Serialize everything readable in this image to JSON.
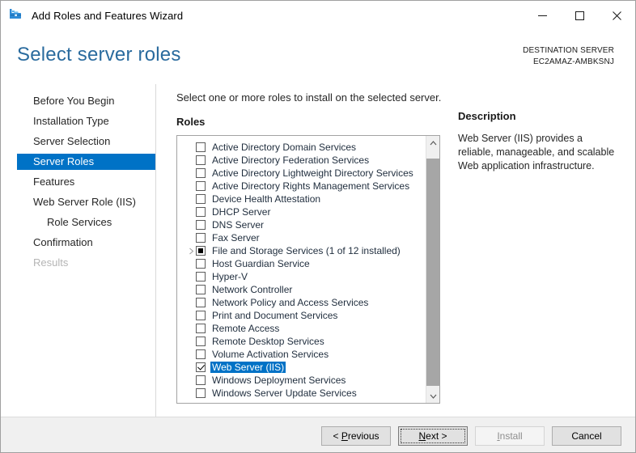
{
  "window": {
    "title": "Add Roles and Features Wizard",
    "icon": "wizard-toolbox-icon",
    "minimize_label": "—",
    "maximize_label": "□",
    "close_label": "✕"
  },
  "header": {
    "page_title": "Select server roles",
    "destination_label": "DESTINATION SERVER",
    "destination_server": "EC2AMAZ-AMBKSNJ",
    "accent_color": "#2a6b9e"
  },
  "nav": {
    "items": [
      {
        "label": "Before You Begin",
        "state": "normal",
        "indent": false
      },
      {
        "label": "Installation Type",
        "state": "normal",
        "indent": false
      },
      {
        "label": "Server Selection",
        "state": "normal",
        "indent": false
      },
      {
        "label": "Server Roles",
        "state": "selected",
        "indent": false
      },
      {
        "label": "Features",
        "state": "normal",
        "indent": false
      },
      {
        "label": "Web Server Role (IIS)",
        "state": "normal",
        "indent": false
      },
      {
        "label": "Role Services",
        "state": "normal",
        "indent": true
      },
      {
        "label": "Confirmation",
        "state": "normal",
        "indent": false
      },
      {
        "label": "Results",
        "state": "disabled",
        "indent": false
      }
    ],
    "selected_bg": "#0072c6"
  },
  "main": {
    "instruction": "Select one or more roles to install on the selected server.",
    "roles_label": "Roles",
    "roles": [
      {
        "label": "Active Directory Domain Services",
        "checkbox": "unchecked",
        "expandable": false,
        "selected": false
      },
      {
        "label": "Active Directory Federation Services",
        "checkbox": "unchecked",
        "expandable": false,
        "selected": false
      },
      {
        "label": "Active Directory Lightweight Directory Services",
        "checkbox": "unchecked",
        "expandable": false,
        "selected": false
      },
      {
        "label": "Active Directory Rights Management Services",
        "checkbox": "unchecked",
        "expandable": false,
        "selected": false
      },
      {
        "label": "Device Health Attestation",
        "checkbox": "unchecked",
        "expandable": false,
        "selected": false
      },
      {
        "label": "DHCP Server",
        "checkbox": "unchecked",
        "expandable": false,
        "selected": false
      },
      {
        "label": "DNS Server",
        "checkbox": "unchecked",
        "expandable": false,
        "selected": false
      },
      {
        "label": "Fax Server",
        "checkbox": "unchecked",
        "expandable": false,
        "selected": false
      },
      {
        "label": "File and Storage Services (1 of 12 installed)",
        "checkbox": "indeterminate",
        "expandable": true,
        "selected": false
      },
      {
        "label": "Host Guardian Service",
        "checkbox": "unchecked",
        "expandable": false,
        "selected": false
      },
      {
        "label": "Hyper-V",
        "checkbox": "unchecked",
        "expandable": false,
        "selected": false
      },
      {
        "label": "Network Controller",
        "checkbox": "unchecked",
        "expandable": false,
        "selected": false
      },
      {
        "label": "Network Policy and Access Services",
        "checkbox": "unchecked",
        "expandable": false,
        "selected": false
      },
      {
        "label": "Print and Document Services",
        "checkbox": "unchecked",
        "expandable": false,
        "selected": false
      },
      {
        "label": "Remote Access",
        "checkbox": "unchecked",
        "expandable": false,
        "selected": false
      },
      {
        "label": "Remote Desktop Services",
        "checkbox": "unchecked",
        "expandable": false,
        "selected": false
      },
      {
        "label": "Volume Activation Services",
        "checkbox": "unchecked",
        "expandable": false,
        "selected": false
      },
      {
        "label": "Web Server (IIS)",
        "checkbox": "checked",
        "expandable": false,
        "selected": true
      },
      {
        "label": "Windows Deployment Services",
        "checkbox": "unchecked",
        "expandable": false,
        "selected": false
      },
      {
        "label": "Windows Server Update Services",
        "checkbox": "unchecked",
        "expandable": false,
        "selected": false
      }
    ],
    "scrollbar": {
      "up_icon": "chevron-up-icon",
      "down_icon": "chevron-down-icon"
    }
  },
  "description": {
    "title": "Description",
    "body": "Web Server (IIS) provides a reliable, manageable, and scalable Web application infrastructure."
  },
  "footer": {
    "buttons": [
      {
        "name": "previous",
        "prefix": "< ",
        "accel": "P",
        "suffix": "revious",
        "state": "normal"
      },
      {
        "name": "next",
        "prefix": "",
        "accel": "N",
        "suffix": "ext >",
        "state": "focused"
      },
      {
        "name": "install",
        "prefix": "",
        "accel": "I",
        "suffix": "nstall",
        "state": "disabled"
      },
      {
        "name": "cancel",
        "prefix": "",
        "accel": "",
        "suffix": "Cancel",
        "state": "normal"
      }
    ]
  }
}
